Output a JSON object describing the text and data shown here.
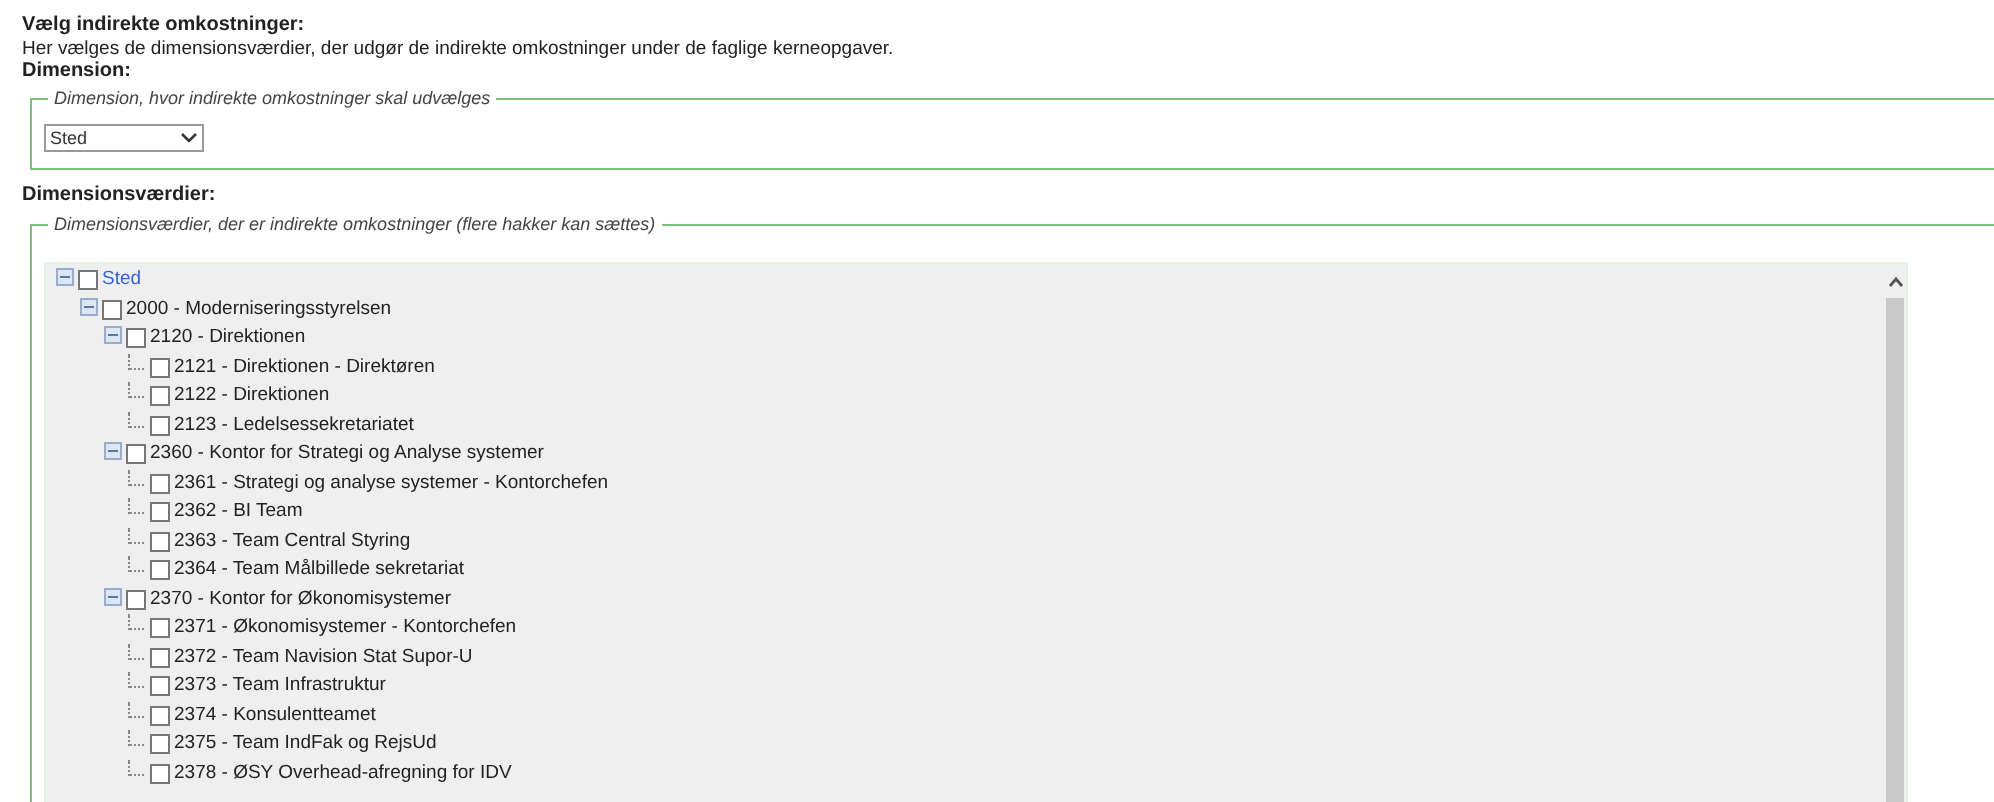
{
  "heading": "Vælg indirekte omkostninger:",
  "description": "Her vælges de dimensionsværdier, der udgør de indirekte omkostninger under de faglige kerneopgaver.",
  "dimension_label": "Dimension:",
  "dimension_group": {
    "legend": "Dimension, hvor indirekte omkostninger skal udvælges",
    "select_value": "Sted"
  },
  "values_label": "Dimensionsværdier:",
  "values_group": {
    "legend": "Dimensionsværdier, der er indirekte omkostninger (flere hakker kan sættes)",
    "tree": [
      {
        "label": "Sted",
        "checked": false,
        "expanded": true,
        "children": [
          {
            "label": "2000 - Moderniseringsstyrelsen",
            "checked": false,
            "expanded": true,
            "children": [
              {
                "label": "2120 - Direktionen",
                "checked": false,
                "expanded": true,
                "children": [
                  {
                    "label": "2121 - Direktionen - Direktøren",
                    "checked": false
                  },
                  {
                    "label": "2122 - Direktionen",
                    "checked": false
                  },
                  {
                    "label": "2123 - Ledelsessekretariatet",
                    "checked": false
                  }
                ]
              },
              {
                "label": "2360 - Kontor for Strategi og Analyse systemer",
                "checked": false,
                "expanded": true,
                "children": [
                  {
                    "label": "2361 - Strategi og analyse systemer - Kontorchefen",
                    "checked": false
                  },
                  {
                    "label": "2362 - BI Team",
                    "checked": false
                  },
                  {
                    "label": "2363 - Team Central Styring",
                    "checked": false
                  },
                  {
                    "label": "2364 - Team Målbillede sekretariat",
                    "checked": false
                  }
                ]
              },
              {
                "label": "2370 - Kontor for Økonomisystemer",
                "checked": false,
                "expanded": true,
                "children": [
                  {
                    "label": "2371 - Økonomisystemer - Kontorchefen",
                    "checked": false
                  },
                  {
                    "label": "2372 - Team Navision Stat Supor-U",
                    "checked": false
                  },
                  {
                    "label": "2373 - Team Infrastruktur",
                    "checked": false
                  },
                  {
                    "label": "2374 - Konsulentteamet",
                    "checked": false
                  },
                  {
                    "label": "2375 - Team IndFak og RejsUd",
                    "checked": false
                  },
                  {
                    "label": "2378 - ØSY Overhead-afregning for IDV",
                    "checked": false
                  }
                ]
              }
            ]
          }
        ]
      }
    ]
  }
}
